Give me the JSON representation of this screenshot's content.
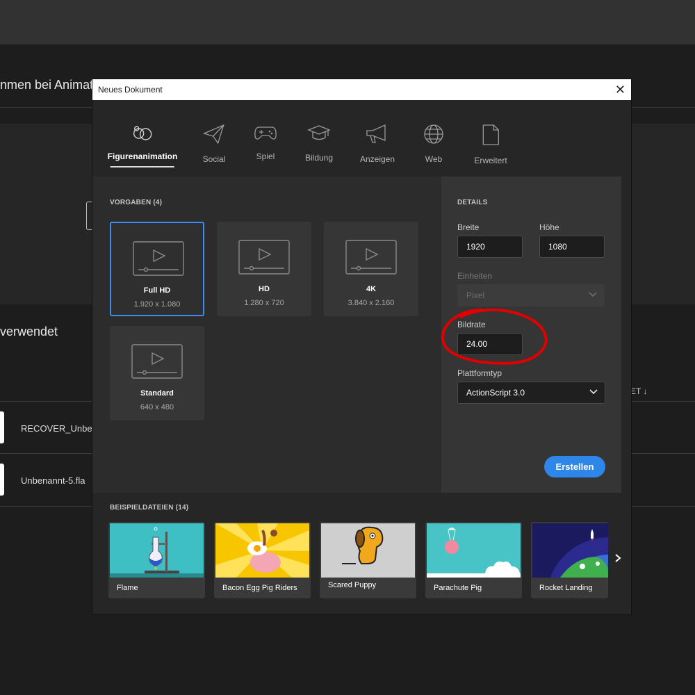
{
  "background": {
    "welcome_text": "nmen bei Animate,",
    "recent_title": "verwendet",
    "sort_label": "ET",
    "sort_arrow": "↓",
    "files": [
      {
        "name": "RECOVER_Unbena"
      },
      {
        "name": "Unbenannt-5.fla"
      }
    ]
  },
  "dialog": {
    "title": "Neues Dokument",
    "close_glyph": "✕",
    "categories": [
      {
        "label": "Figurenanimation",
        "icon": "figure-animation-icon",
        "active": true
      },
      {
        "label": "Social",
        "icon": "paper-plane-icon"
      },
      {
        "label": "Spiel",
        "icon": "gamepad-icon"
      },
      {
        "label": "Bildung",
        "icon": "graduation-cap-icon"
      },
      {
        "label": "Anzeigen",
        "icon": "megaphone-icon"
      },
      {
        "label": "Web",
        "icon": "globe-icon"
      },
      {
        "label": "Erweitert",
        "icon": "document-icon"
      }
    ],
    "presets_title": "VORGABEN (4)",
    "presets": [
      {
        "name": "Full HD",
        "dims": "1.920 x 1.080",
        "selected": true
      },
      {
        "name": "HD",
        "dims": "1.280 x 720"
      },
      {
        "name": "4K",
        "dims": "3.840 x 2.160"
      },
      {
        "name": "Standard",
        "dims": "640 x 480"
      }
    ],
    "details": {
      "title": "DETAILS",
      "width_label": "Breite",
      "width_value": "1920",
      "height_label": "Höhe",
      "height_value": "1080",
      "units_label": "Einheiten",
      "units_value": "Pixel",
      "framerate_label": "Bildrate",
      "framerate_value": "24.00",
      "platform_label": "Plattformtyp",
      "platform_value": "ActionScript 3.0"
    },
    "create_label": "Erstellen",
    "samples_title": "BEISPIELDATEIEN (14)",
    "samples": [
      {
        "name": "Flame"
      },
      {
        "name": "Bacon Egg Pig Riders"
      },
      {
        "name": "Scared Puppy"
      },
      {
        "name": "Parachute Pig"
      },
      {
        "name": "Rocket Landing"
      }
    ],
    "colors": {
      "accent": "#2d86e8",
      "selection_border": "#3b8ef3",
      "annotation": "#e00000"
    }
  }
}
